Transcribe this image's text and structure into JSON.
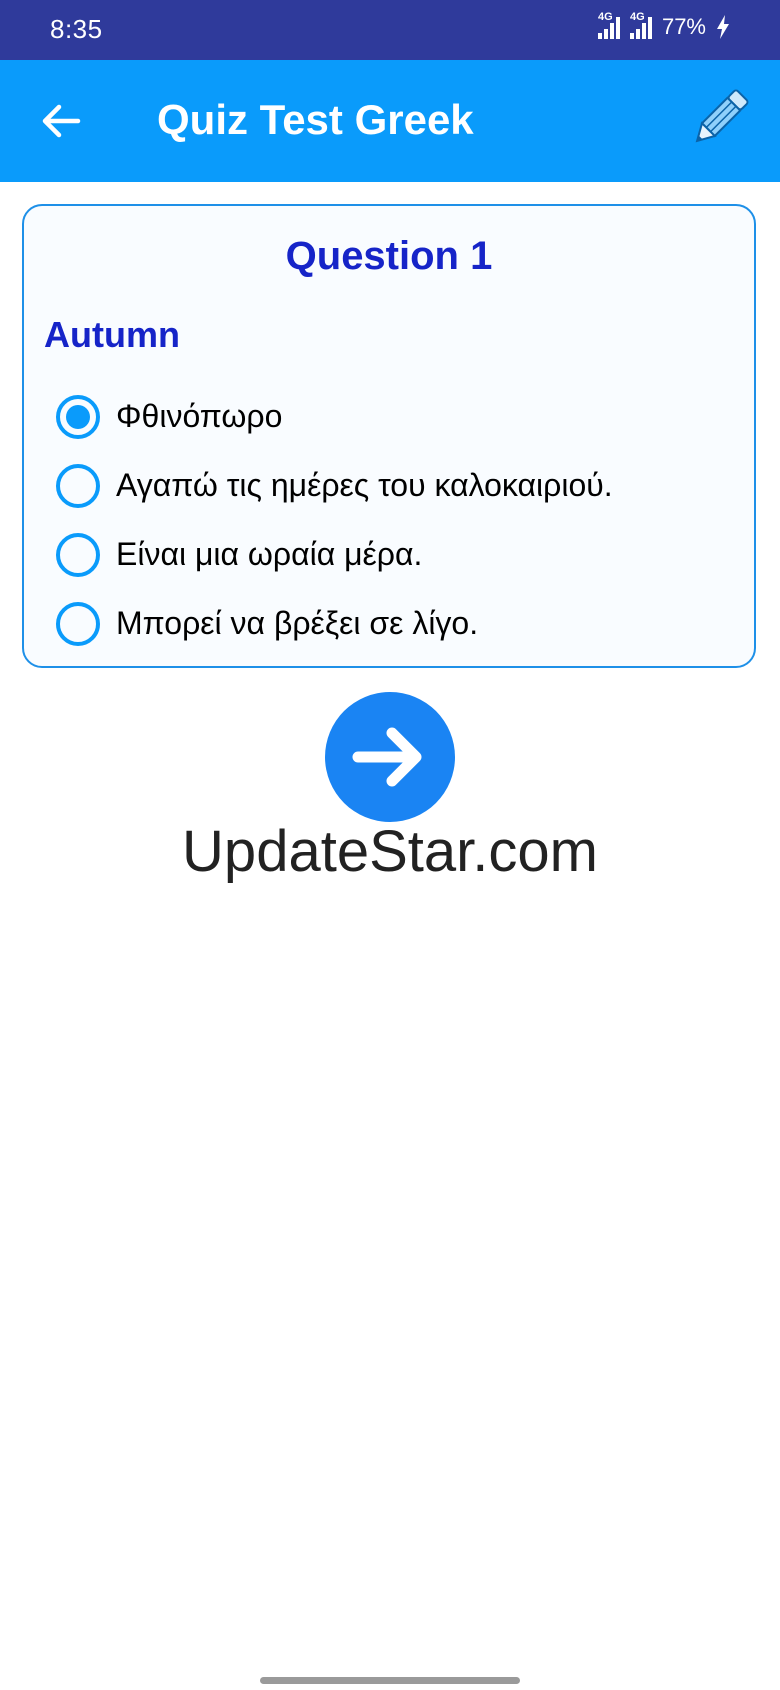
{
  "status_bar": {
    "time": "8:35",
    "network_1": "4G",
    "network_2": "4G",
    "battery": "77%"
  },
  "app_bar": {
    "title": "Quiz Test Greek",
    "icons": [
      "back-arrow-icon",
      "pencil-icon"
    ]
  },
  "question": {
    "title": "Question 1",
    "word": "Autumn",
    "selected_index": 0,
    "options": [
      {
        "label": "Φθινόπωρο",
        "selected": true
      },
      {
        "label": "Αγαπώ τις ημέρες του καλοκαιριού.",
        "selected": false
      },
      {
        "label": "Είναι μια ωραία μέρα.",
        "selected": false
      },
      {
        "label": "Μπορεί να βρέξει σε λίγο.",
        "selected": false
      }
    ]
  },
  "next_button": {
    "icon": "arrow-right-icon"
  },
  "watermark": "UpdateStar.com",
  "colors": {
    "status_bar": "#2f3a9b",
    "app_bar": "#0a9bfb",
    "question_text": "#1624c8",
    "accent": "#0a9bfb",
    "next_button": "#1a84f3"
  }
}
